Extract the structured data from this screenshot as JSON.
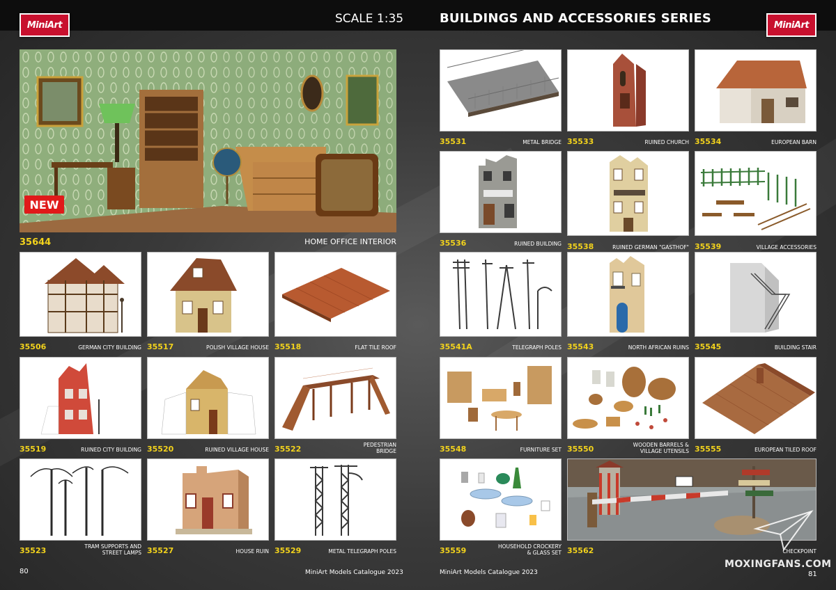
{
  "header": {
    "logo_left": "MiniArt",
    "logo_right": "MiniArt",
    "scale": "SCALE 1:35",
    "series_title": "BUILDINGS AND ACCESSORIES SERIES"
  },
  "hero": {
    "code": "35644",
    "name": "HOME OFFICE INTERIOR",
    "badge": "NEW"
  },
  "left_items": [
    {
      "code": "35506",
      "name": "GERMAN CITY BUILDING"
    },
    {
      "code": "35517",
      "name": "POLISH VILLAGE HOUSE"
    },
    {
      "code": "35518",
      "name": "FLAT TILE ROOF"
    },
    {
      "code": "35519",
      "name": "RUINED CITY BUILDING"
    },
    {
      "code": "35520",
      "name": "RUINED VILLAGE HOUSE"
    },
    {
      "code": "35522",
      "name_line1": "PEDESTRIAN",
      "name_line2": "BRIDGE"
    },
    {
      "code": "35523",
      "name_line1": "TRAM SUPPORTS AND",
      "name_line2": "STREET LAMPS"
    },
    {
      "code": "35527",
      "name": "HOUSE RUIN"
    },
    {
      "code": "35529",
      "name": "METAL TELEGRAPH POLES"
    }
  ],
  "right_items": [
    {
      "code": "35531",
      "name": "METAL BRIDGE"
    },
    {
      "code": "35533",
      "name": "RUINED CHURCH"
    },
    {
      "code": "35534",
      "name": "EUROPEAN BARN"
    },
    {
      "code": "35536",
      "name": "RUINED BUILDING"
    },
    {
      "code": "35538",
      "name": "RUINED GERMAN \"GASTHOF\""
    },
    {
      "code": "35539",
      "name": "VILLAGE ACCESSORIES"
    },
    {
      "code": "35541A",
      "name": "TELEGRAPH POLES"
    },
    {
      "code": "35543",
      "name": "NORTH AFRICAN RUINS"
    },
    {
      "code": "35545",
      "name": "BUILDING STAIR"
    },
    {
      "code": "35548",
      "name": "FURNITURE SET"
    },
    {
      "code": "35550",
      "name_line1": "WOODEN BARRELS &",
      "name_line2": "VILLAGE UTENSILS"
    },
    {
      "code": "35555",
      "name": "EUROPEAN TILED ROOF"
    },
    {
      "code": "35559",
      "name_line1": "HOUSEHOLD CROCKERY",
      "name_line2": "& GLASS SET"
    },
    {
      "code": "35562",
      "name": "CHECKPOINT"
    }
  ],
  "footer": {
    "left_page": "80",
    "left_text": "MiniArt Models Catalogue 2023",
    "right_text": "MiniArt Models Catalogue 2023",
    "right_page": "81",
    "watermark": "MOXINGFANS.COM"
  },
  "colors": {
    "code_yellow": "#f2d21c",
    "brand_red": "#c8102e",
    "badge_red": "#e01a1a"
  }
}
